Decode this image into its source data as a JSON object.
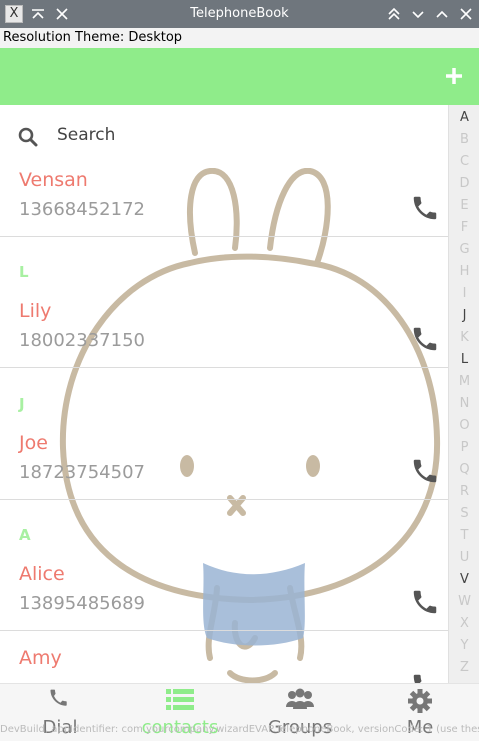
{
  "window": {
    "title": "TelephoneBook",
    "controls": [
      "minimize-all-icon",
      "close-icon",
      "double-chevron-up-icon",
      "chevron-down-icon",
      "chevron-up-icon",
      "close-icon"
    ]
  },
  "theme_bar": {
    "text": "Resolution Theme: Desktop"
  },
  "header": {
    "add_icon": "plus-icon",
    "color": "#8fec8a"
  },
  "search": {
    "label": "Search",
    "icon": "search-icon"
  },
  "contacts": [
    {
      "section": "",
      "name": "Vensan",
      "number": "13668452172"
    },
    {
      "section": "L",
      "name": "Lily",
      "number": "18002337150"
    },
    {
      "section": "J",
      "name": "Joe",
      "number": "18723754507"
    },
    {
      "section": "A",
      "name": "Alice",
      "number": "13895485689"
    },
    {
      "section": "",
      "name": "Amy",
      "number": ""
    }
  ],
  "index_letters": [
    "A",
    "B",
    "C",
    "D",
    "E",
    "F",
    "G",
    "H",
    "I",
    "J",
    "K",
    "L",
    "M",
    "N",
    "O",
    "P",
    "Q",
    "R",
    "S",
    "T",
    "U",
    "V",
    "W",
    "X",
    "Y",
    "Z"
  ],
  "index_active": [
    "A",
    "J",
    "L",
    "V"
  ],
  "tabs": [
    {
      "label": "Dial",
      "icon": "phone-icon"
    },
    {
      "label": "contacts",
      "icon": "list-icon"
    },
    {
      "label": "Groups",
      "icon": "group-icon"
    },
    {
      "label": "Me",
      "icon": "gear-icon"
    }
  ],
  "active_tab": "contacts",
  "dev_log": "DevBuild, appIdentifier: com.yourcompany.wizardEVAP.TelephoneBook, versionCode: 1 (use these"
}
